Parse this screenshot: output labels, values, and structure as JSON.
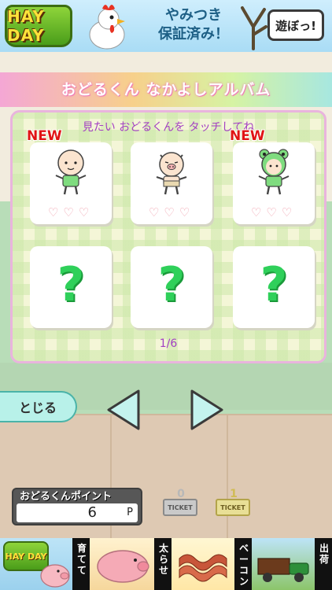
{
  "top_ad": {
    "logo_text": "HAY DAY",
    "headline_line1": "やみつき",
    "headline_line2": "保証済み！",
    "cta_label": "遊ぼっ!"
  },
  "album": {
    "title": "おどるくん なかよしアルバム",
    "instruction": "見たい おどるくんを タッチしてね",
    "page_indicator": "1/6",
    "new_badge": "NEW",
    "hearts": "♡♡♡",
    "unknown_mark": "?",
    "cards": [
      {
        "state": "unlocked",
        "is_new": true,
        "character": "bald-boy"
      },
      {
        "state": "unlocked",
        "is_new": false,
        "character": "pig-boy"
      },
      {
        "state": "unlocked",
        "is_new": true,
        "character": "frog-boy"
      },
      {
        "state": "locked"
      },
      {
        "state": "locked"
      },
      {
        "state": "locked"
      }
    ]
  },
  "controls": {
    "close_label": "とじる",
    "prev_icon": "triangle-left-icon",
    "next_icon": "triangle-right-icon"
  },
  "points": {
    "label": "おどるくんポイント",
    "value": "6",
    "unit": "P"
  },
  "tickets": [
    {
      "count": "0",
      "label": "TICKET",
      "color": "#c9c9c9"
    },
    {
      "count": "1",
      "label": "TICKET",
      "color": "#e8df96"
    }
  ],
  "bottom_ad": {
    "logo_text": "HAY DAY",
    "labels": [
      "育てて",
      "太らせ",
      "ベーコン",
      "出荷"
    ]
  },
  "colors": {
    "title_gradient": [
      "#f4a7d5",
      "#f7d08b",
      "#d6f3a3",
      "#a7e7e0"
    ],
    "instruction_text": "#a33fc3",
    "new_badge": "#e01414",
    "question_mark": "#2fd05a",
    "close_button": "#b8f1e9",
    "arrow_fill": "#c4f3ee"
  }
}
